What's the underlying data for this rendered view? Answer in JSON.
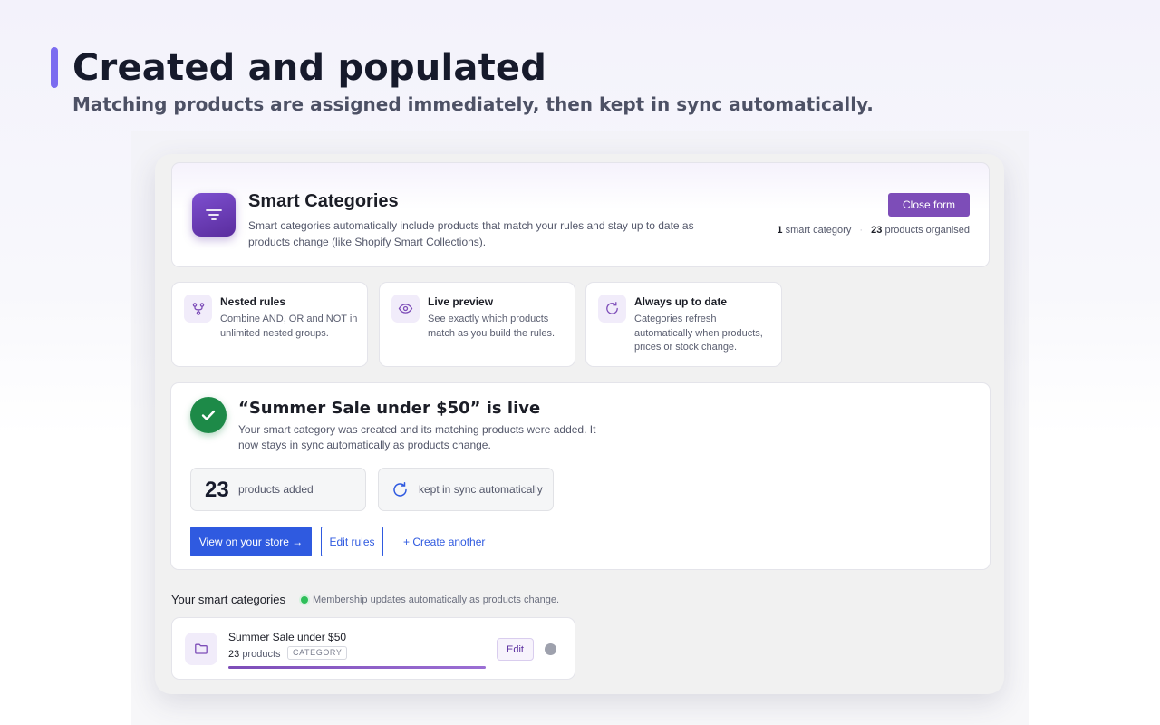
{
  "hero": {
    "title": "Created and populated",
    "subtitle": "Matching products are assigned immediately, then kept in sync automatically."
  },
  "header": {
    "title": "Smart Categories",
    "description": "Smart categories automatically include products that match your rules and stay up to date as products change (like Shopify Smart Collections).",
    "close_label": "Close form",
    "stats": {
      "category_count": "1",
      "category_label": "smart category",
      "separator": "·",
      "product_count": "23",
      "product_label": "products organised"
    }
  },
  "features": [
    {
      "title": "Nested rules",
      "desc": "Combine AND, OR and NOT in unlimited nested groups.",
      "icon": "branch-icon"
    },
    {
      "title": "Live preview",
      "desc": "See exactly which products match as you build the rules.",
      "icon": "eye-icon"
    },
    {
      "title": "Always up to date",
      "desc": "Categories refresh automatically when products, prices or stock change.",
      "icon": "refresh-icon"
    }
  ],
  "success": {
    "title": "“Summer Sale under $50” is live",
    "description": "Your smart category was created and its matching products were added. It now stays in sync automatically as products change.",
    "count": "23",
    "count_label": "products added",
    "sync_label": "kept in sync automatically",
    "view_label": "View on your store →",
    "edit_label": "Edit rules",
    "create_label": "+ Create another"
  },
  "list": {
    "heading": "Your smart categories",
    "note": "Membership updates automatically as products change.",
    "items": [
      {
        "title": "Summer Sale under $50",
        "count": "23",
        "count_label": "products",
        "badge": "CATEGORY",
        "progress": 1.0,
        "edit_label": "Edit"
      }
    ]
  },
  "colors": {
    "accent": "#7d4db8",
    "primary": "#2f5ae0",
    "success": "#1d8a48",
    "hero_accent": "#7b6cf0"
  }
}
